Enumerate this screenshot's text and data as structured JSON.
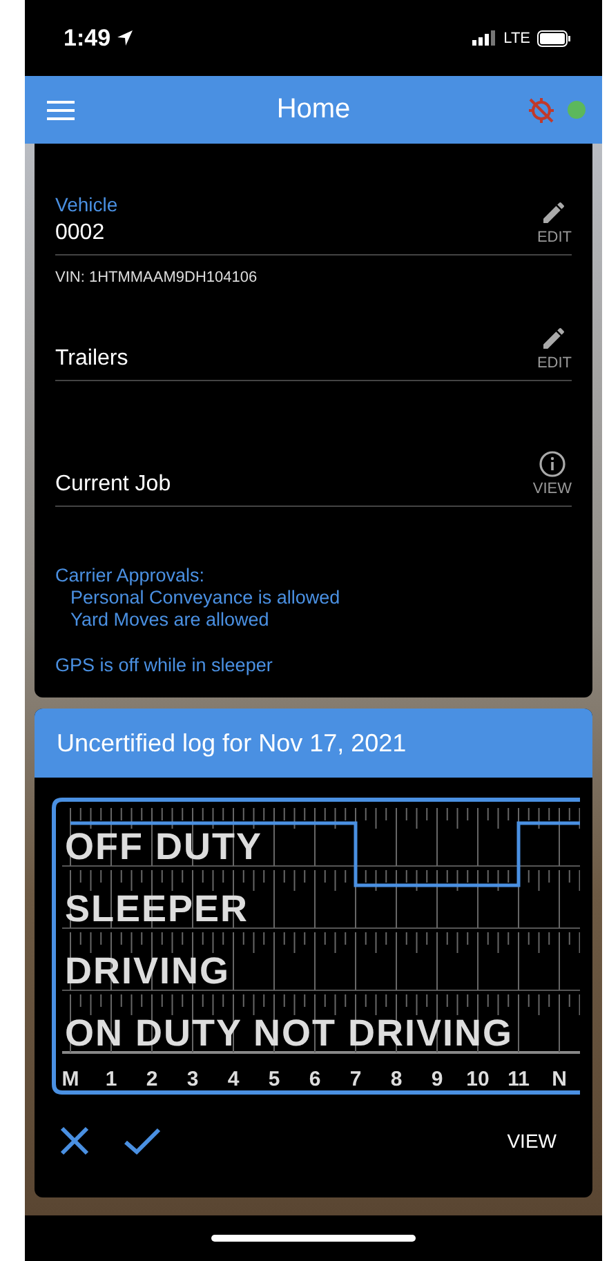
{
  "status_bar": {
    "time": "1:49",
    "network": "LTE"
  },
  "app_bar": {
    "title": "Home",
    "gps_disabled": true,
    "connected": true
  },
  "vehicle": {
    "label": "Vehicle",
    "value": "0002",
    "action": "EDIT",
    "vin": "VIN: 1HTMMAAM9DH104106"
  },
  "trailers": {
    "label": "Trailers",
    "action": "EDIT"
  },
  "current_job": {
    "label": "Current Job",
    "action": "VIEW"
  },
  "carrier_approvals": {
    "title": "Carrier Approvals:",
    "items": [
      "Personal Conveyance is allowed",
      "Yard Moves are allowed"
    ]
  },
  "gps_notice": "GPS is off while in sleeper",
  "log_card": {
    "title": "Uncertified log for Nov 17, 2021",
    "view_action": "VIEW",
    "graph": {
      "statuses": [
        "OFF DUTY",
        "SLEEPER",
        "DRIVING",
        "ON DUTY NOT DRIVING"
      ],
      "hours": [
        "M",
        "1",
        "2",
        "3",
        "4",
        "5",
        "6",
        "7",
        "8",
        "9",
        "10",
        "11",
        "N"
      ]
    }
  }
}
